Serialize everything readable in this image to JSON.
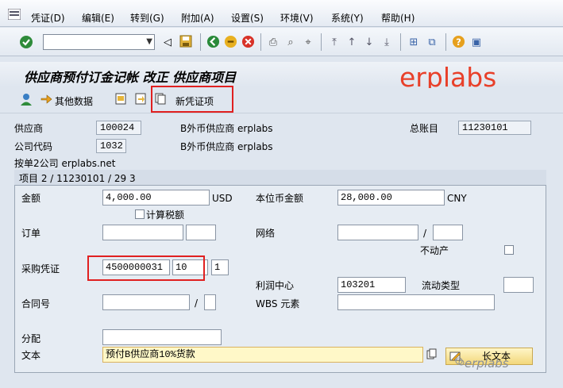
{
  "menu": [
    "凭证(D)",
    "编辑(E)",
    "转到(G)",
    "附加(A)",
    "设置(S)",
    "环境(V)",
    "系统(Y)",
    "帮助(H)"
  ],
  "toolbar": {
    "command_value": ""
  },
  "title": "供应商预付订金记帐 改正 供应商项目",
  "watermark": "erplabs",
  "app_toolbar": {
    "other_data": "其他数据",
    "new_item": "新凭证项"
  },
  "header": {
    "vendor_label": "供应商",
    "vendor_value": "100024",
    "vendor_name": "B外币供应商 erplabs",
    "gl_label": "总账目",
    "gl_value": "11230101",
    "company_label": "公司代码",
    "company_value": "1032",
    "company_name": "B外币供应商 erplabs",
    "company_text": "按单2公司 erplabs.net"
  },
  "item": {
    "group_title": "项目 2 / 11230101 / 29 3",
    "amount_label": "金额",
    "amount_value": "4,000.00",
    "amount_currency": "USD",
    "local_amount_label": "本位币金额",
    "local_amount_value": "28,000.00",
    "local_currency": "CNY",
    "calc_tax_label": "计算税额",
    "order_label": "订单",
    "network_label": "网络",
    "network_sep": "/",
    "real_estate_label": "不动产",
    "po_label": "采购凭证",
    "po_value": "4500000031",
    "po_item": "10",
    "po_extra": "1",
    "profit_center_label": "利润中心",
    "profit_center_value": "103201",
    "flow_type_label": "流动类型",
    "contract_label": "合同号",
    "contract_sep": "/",
    "wbs_label": "WBS 元素",
    "assignment_label": "分配",
    "text_label": "文本",
    "text_value": "预付B供应商10%货款",
    "long_text_button": "长文本"
  },
  "wechat_watermark": "erplabs",
  "colors": {
    "accent_red": "#e02020",
    "watermark": "#e8402a"
  }
}
